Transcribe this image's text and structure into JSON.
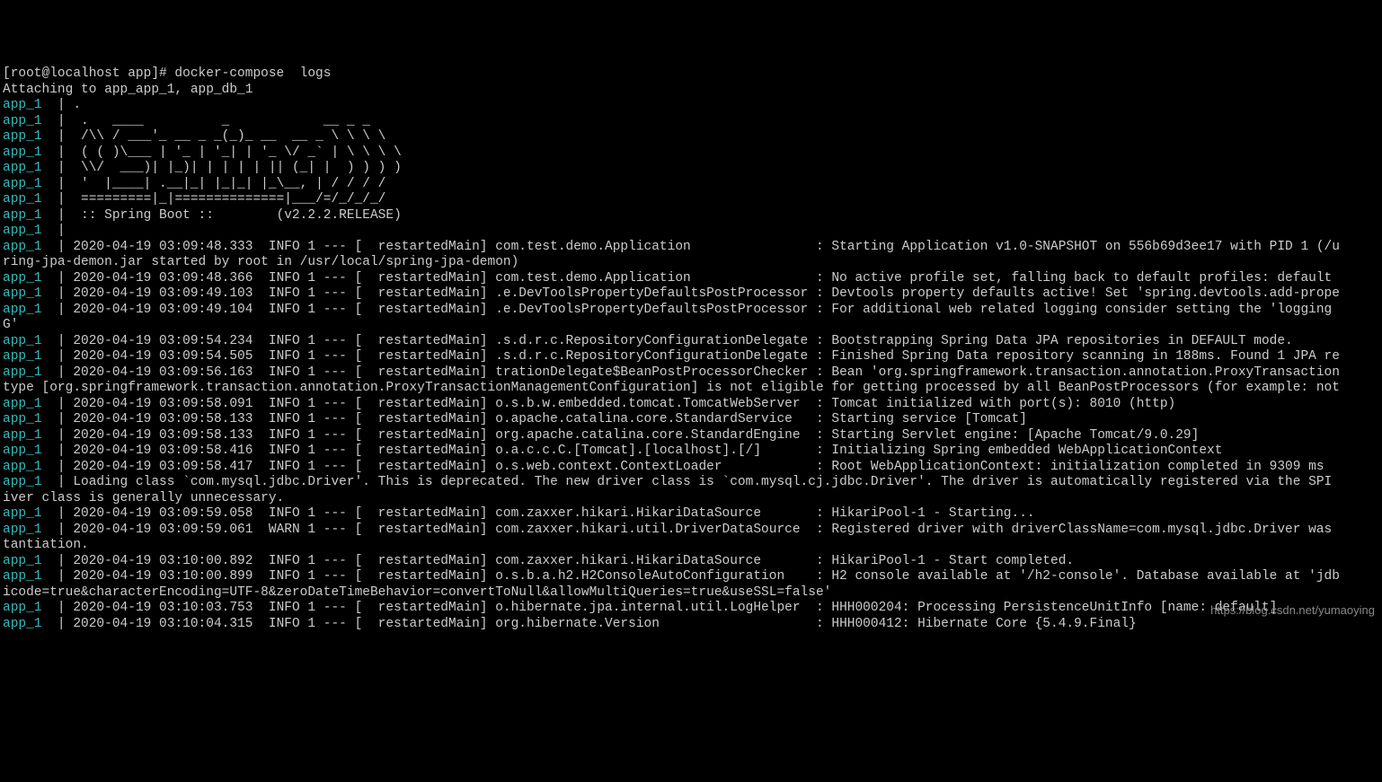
{
  "prompt": "[root@localhost app]# docker-compose  logs",
  "attach": "Attaching to app_app_1, app_db_1",
  "prefix": "app_1",
  "ascii": [
    ".   ____          _            __ _ _",
    "/\\\\ / ___'_ __ _ _(_)_ __  __ _ \\ \\ \\ \\",
    "( ( )\\___ | '_ | '_| | '_ \\/ _` | \\ \\ \\ \\",
    "\\\\/  ___)| |_)| | | | | || (_| |  ) ) ) )",
    "'  |____| .__|_| |_|_| |_\\__, | / / / /",
    "=========|_|==============|___/=/_/_/_/",
    ":: Spring Boot ::        (v2.2.2.RELEASE)"
  ],
  "lines": [
    "2020-04-19 03:09:48.333  INFO 1 --- [  restartedMain] com.test.demo.Application                : Starting Application v1.0-SNAPSHOT on 556b69d3ee17 with PID 1 (/u",
    "CONT:ring-jpa-demon.jar started by root in /usr/local/spring-jpa-demon)",
    "2020-04-19 03:09:48.366  INFO 1 --- [  restartedMain] com.test.demo.Application                : No active profile set, falling back to default profiles: default",
    "2020-04-19 03:09:49.103  INFO 1 --- [  restartedMain] .e.DevToolsPropertyDefaultsPostProcessor : Devtools property defaults active! Set 'spring.devtools.add-prope",
    "2020-04-19 03:09:49.104  INFO 1 --- [  restartedMain] .e.DevToolsPropertyDefaultsPostProcessor : For additional web related logging consider setting the 'logging",
    "CONT:G'",
    "2020-04-19 03:09:54.234  INFO 1 --- [  restartedMain] .s.d.r.c.RepositoryConfigurationDelegate : Bootstrapping Spring Data JPA repositories in DEFAULT mode.",
    "2020-04-19 03:09:54.505  INFO 1 --- [  restartedMain] .s.d.r.c.RepositoryConfigurationDelegate : Finished Spring Data repository scanning in 188ms. Found 1 JPA re",
    "2020-04-19 03:09:56.163  INFO 1 --- [  restartedMain] trationDelegate$BeanPostProcessorChecker : Bean 'org.springframework.transaction.annotation.ProxyTransaction",
    "CONT:type [org.springframework.transaction.annotation.ProxyTransactionManagementConfiguration] is not eligible for getting processed by all BeanPostProcessors (for example: not",
    "2020-04-19 03:09:58.091  INFO 1 --- [  restartedMain] o.s.b.w.embedded.tomcat.TomcatWebServer  : Tomcat initialized with port(s): 8010 (http)",
    "2020-04-19 03:09:58.133  INFO 1 --- [  restartedMain] o.apache.catalina.core.StandardService   : Starting service [Tomcat]",
    "2020-04-19 03:09:58.133  INFO 1 --- [  restartedMain] org.apache.catalina.core.StandardEngine  : Starting Servlet engine: [Apache Tomcat/9.0.29]",
    "2020-04-19 03:09:58.416  INFO 1 --- [  restartedMain] o.a.c.c.C.[Tomcat].[localhost].[/]       : Initializing Spring embedded WebApplicationContext",
    "2020-04-19 03:09:58.417  INFO 1 --- [  restartedMain] o.s.web.context.ContextLoader            : Root WebApplicationContext: initialization completed in 9309 ms",
    "Loading class `com.mysql.jdbc.Driver'. This is deprecated. The new driver class is `com.mysql.cj.jdbc.Driver'. The driver is automatically registered via the SPI",
    "CONT:iver class is generally unnecessary.",
    "2020-04-19 03:09:59.058  INFO 1 --- [  restartedMain] com.zaxxer.hikari.HikariDataSource       : HikariPool-1 - Starting...",
    "2020-04-19 03:09:59.061  WARN 1 --- [  restartedMain] com.zaxxer.hikari.util.DriverDataSource  : Registered driver with driverClassName=com.mysql.jdbc.Driver was ",
    "CONT:tantiation.",
    "2020-04-19 03:10:00.892  INFO 1 --- [  restartedMain] com.zaxxer.hikari.HikariDataSource       : HikariPool-1 - Start completed.",
    "2020-04-19 03:10:00.899  INFO 1 --- [  restartedMain] o.s.b.a.h2.H2ConsoleAutoConfiguration    : H2 console available at '/h2-console'. Database available at 'jdb",
    "CONT:icode=true&characterEncoding=UTF-8&zeroDateTimeBehavior=convertToNull&allowMultiQueries=true&useSSL=false'",
    "2020-04-19 03:10:03.753  INFO 1 --- [  restartedMain] o.hibernate.jpa.internal.util.LogHelper  : HHH000204: Processing PersistenceUnitInfo [name: default]",
    "2020-04-19 03:10:04.315  INFO 1 --- [  restartedMain] org.hibernate.Version                    : HHH000412: Hibernate Core {5.4.9.Final}"
  ],
  "watermark": "https://blog.csdn.net/yumaoying"
}
